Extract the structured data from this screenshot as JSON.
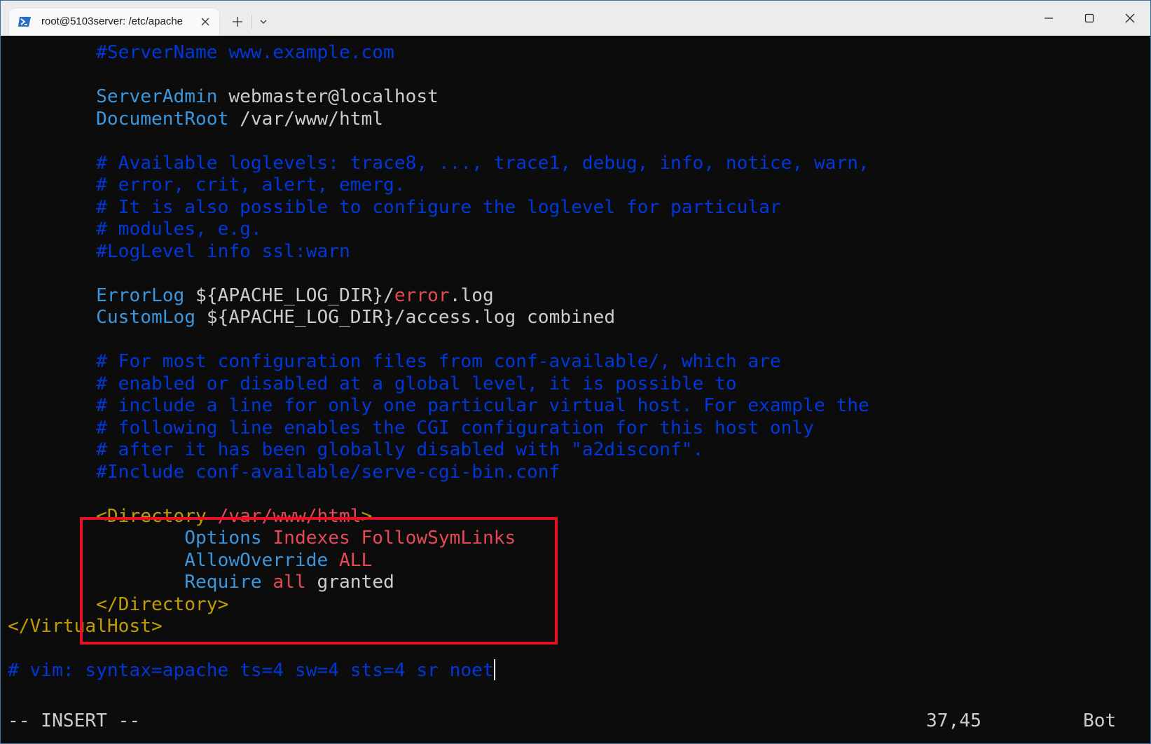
{
  "window": {
    "tab_title": "root@5103server: /etc/apache",
    "icons": {
      "tab": "powershell-icon",
      "tab_close": "close-icon",
      "new_tab": "plus-icon",
      "dropdown": "chevron-down-icon",
      "minimize": "minimize-icon",
      "maximize": "maximize-icon",
      "close": "close-icon"
    }
  },
  "colors": {
    "background": "#0c0c0c",
    "keyword": "#3a96dd",
    "text": "#cccccc",
    "comment": "#0037da",
    "value_red": "#e74856",
    "tag_orange": "#c19c00",
    "highlight_box": "#e81123"
  },
  "editor": {
    "lines": [
      {
        "indent": "        ",
        "segments": [
          {
            "cls": "cm",
            "text": "#ServerName www.example.com"
          }
        ]
      },
      {
        "indent": "",
        "segments": []
      },
      {
        "indent": "        ",
        "segments": [
          {
            "cls": "kw",
            "text": "ServerAdmin"
          },
          {
            "cls": "txt",
            "text": " webmaster@localhost"
          }
        ]
      },
      {
        "indent": "        ",
        "segments": [
          {
            "cls": "kw",
            "text": "DocumentRoot"
          },
          {
            "cls": "txt",
            "text": " /var/www/html"
          }
        ]
      },
      {
        "indent": "",
        "segments": []
      },
      {
        "indent": "        ",
        "segments": [
          {
            "cls": "cm",
            "text": "# Available loglevels: trace8, ..., trace1, debug, info, notice, warn,"
          }
        ]
      },
      {
        "indent": "        ",
        "segments": [
          {
            "cls": "cm",
            "text": "# error, crit, alert, emerg."
          }
        ]
      },
      {
        "indent": "        ",
        "segments": [
          {
            "cls": "cm",
            "text": "# It is also possible to configure the loglevel for particular"
          }
        ]
      },
      {
        "indent": "        ",
        "segments": [
          {
            "cls": "cm",
            "text": "# modules, e.g."
          }
        ]
      },
      {
        "indent": "        ",
        "segments": [
          {
            "cls": "cm",
            "text": "#LogLevel info ssl:warn"
          }
        ]
      },
      {
        "indent": "",
        "segments": []
      },
      {
        "indent": "        ",
        "segments": [
          {
            "cls": "kw",
            "text": "ErrorLog"
          },
          {
            "cls": "txt",
            "text": " ${APACHE_LOG_DIR}/"
          },
          {
            "cls": "rd",
            "text": "error"
          },
          {
            "cls": "txt",
            "text": ".log"
          }
        ]
      },
      {
        "indent": "        ",
        "segments": [
          {
            "cls": "kw",
            "text": "CustomLog"
          },
          {
            "cls": "txt",
            "text": " ${APACHE_LOG_DIR}/access.log combined"
          }
        ]
      },
      {
        "indent": "",
        "segments": []
      },
      {
        "indent": "        ",
        "segments": [
          {
            "cls": "cm",
            "text": "# For most configuration files from conf-available/, which are"
          }
        ]
      },
      {
        "indent": "        ",
        "segments": [
          {
            "cls": "cm",
            "text": "# enabled or disabled at a global level, it is possible to"
          }
        ]
      },
      {
        "indent": "        ",
        "segments": [
          {
            "cls": "cm",
            "text": "# include a line for only one particular virtual host. For example the"
          }
        ]
      },
      {
        "indent": "        ",
        "segments": [
          {
            "cls": "cm",
            "text": "# following line enables the CGI configuration for this host only"
          }
        ]
      },
      {
        "indent": "        ",
        "segments": [
          {
            "cls": "cm",
            "text": "# after it has been globally disabled with \"a2disconf\"."
          }
        ]
      },
      {
        "indent": "        ",
        "segments": [
          {
            "cls": "cm",
            "text": "#Include conf-available/serve-cgi-bin.conf"
          }
        ]
      },
      {
        "indent": "",
        "segments": []
      },
      {
        "indent": "        ",
        "segments": [
          {
            "cls": "or",
            "text": "<Directory"
          },
          {
            "cls": "rd",
            "text": " /var/www/html"
          },
          {
            "cls": "or",
            "text": ">"
          }
        ]
      },
      {
        "indent": "                ",
        "segments": [
          {
            "cls": "kw",
            "text": "Options"
          },
          {
            "cls": "rd",
            "text": " Indexes FollowSymLinks"
          }
        ]
      },
      {
        "indent": "                ",
        "segments": [
          {
            "cls": "kw",
            "text": "AllowOverride"
          },
          {
            "cls": "rd",
            "text": " ALL"
          }
        ]
      },
      {
        "indent": "                ",
        "segments": [
          {
            "cls": "kw",
            "text": "Require"
          },
          {
            "cls": "rd",
            "text": " all"
          },
          {
            "cls": "txt",
            "text": " granted"
          }
        ]
      },
      {
        "indent": "        ",
        "segments": [
          {
            "cls": "or",
            "text": "</Directory>"
          }
        ]
      },
      {
        "indent": "",
        "segments": [
          {
            "cls": "or",
            "text": "</VirtualHost>"
          }
        ]
      },
      {
        "indent": "",
        "segments": []
      },
      {
        "indent": "",
        "segments": [
          {
            "cls": "cm",
            "text": "# vim: syntax=apache ts=4 sw=4 sts=4 sr noet"
          }
        ],
        "cursor": true
      }
    ]
  },
  "status": {
    "mode": "-- INSERT --",
    "position": "37,45",
    "scroll": "Bot"
  }
}
